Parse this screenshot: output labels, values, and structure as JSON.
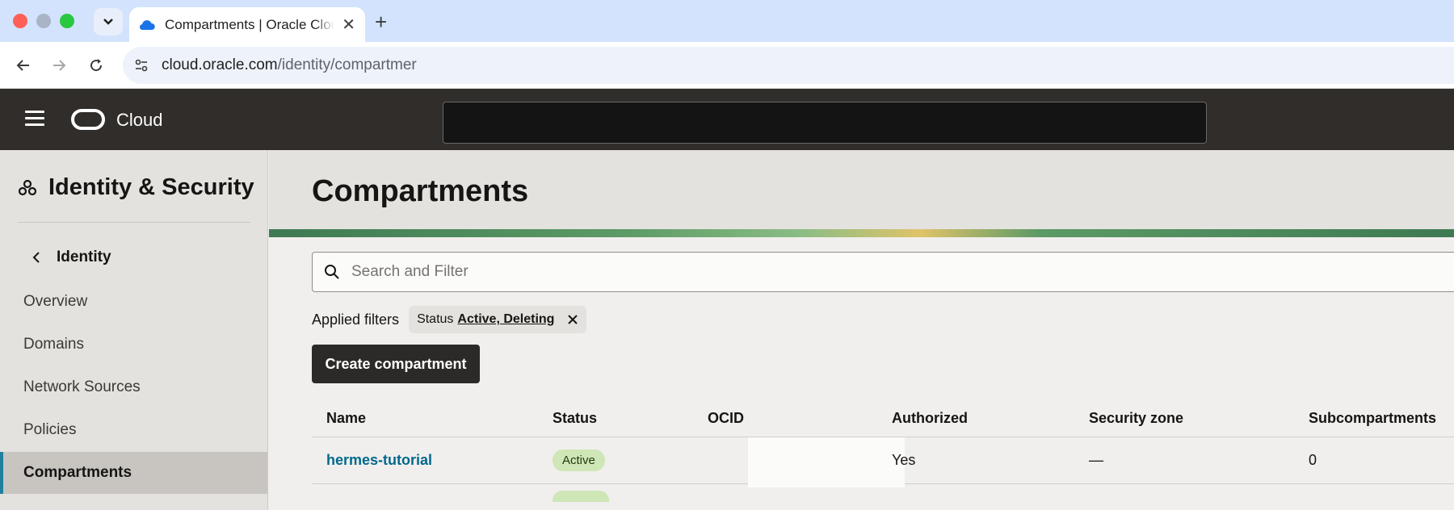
{
  "browser": {
    "tab_title": "Compartments | Oracle Cloud",
    "tab_close": "✕",
    "new_tab": "+",
    "url_host": "cloud.oracle.com",
    "url_path": "/identity/compartmer"
  },
  "header": {
    "brand": "Cloud"
  },
  "sidebar": {
    "title": "Identity & Security",
    "back_label": "Identity",
    "items": [
      {
        "label": "Overview",
        "active": false
      },
      {
        "label": "Domains",
        "active": false
      },
      {
        "label": "Network Sources",
        "active": false
      },
      {
        "label": "Policies",
        "active": false
      },
      {
        "label": "Compartments",
        "active": true
      }
    ]
  },
  "main": {
    "title": "Compartments",
    "search_placeholder": "Search and Filter",
    "applied_filters_label": "Applied filters",
    "filter_chip": {
      "key": "Status",
      "value": "Active, Deleting"
    },
    "create_button": "Create compartment",
    "columns": [
      "Name",
      "Status",
      "OCID",
      "Authorized",
      "Security zone",
      "Subcompartments"
    ],
    "rows": [
      {
        "name": "hermes-tutorial",
        "status": "Active",
        "ocid": "",
        "authorized": "Yes",
        "security_zone": "—",
        "subcompartments": "0"
      }
    ]
  },
  "colors": {
    "header_bg": "#312d2a",
    "sidebar_active_accent": "#227e9e",
    "link": "#00688c",
    "status_active_bg": "#cfe6b7",
    "primary_button": "#2c2a28"
  }
}
